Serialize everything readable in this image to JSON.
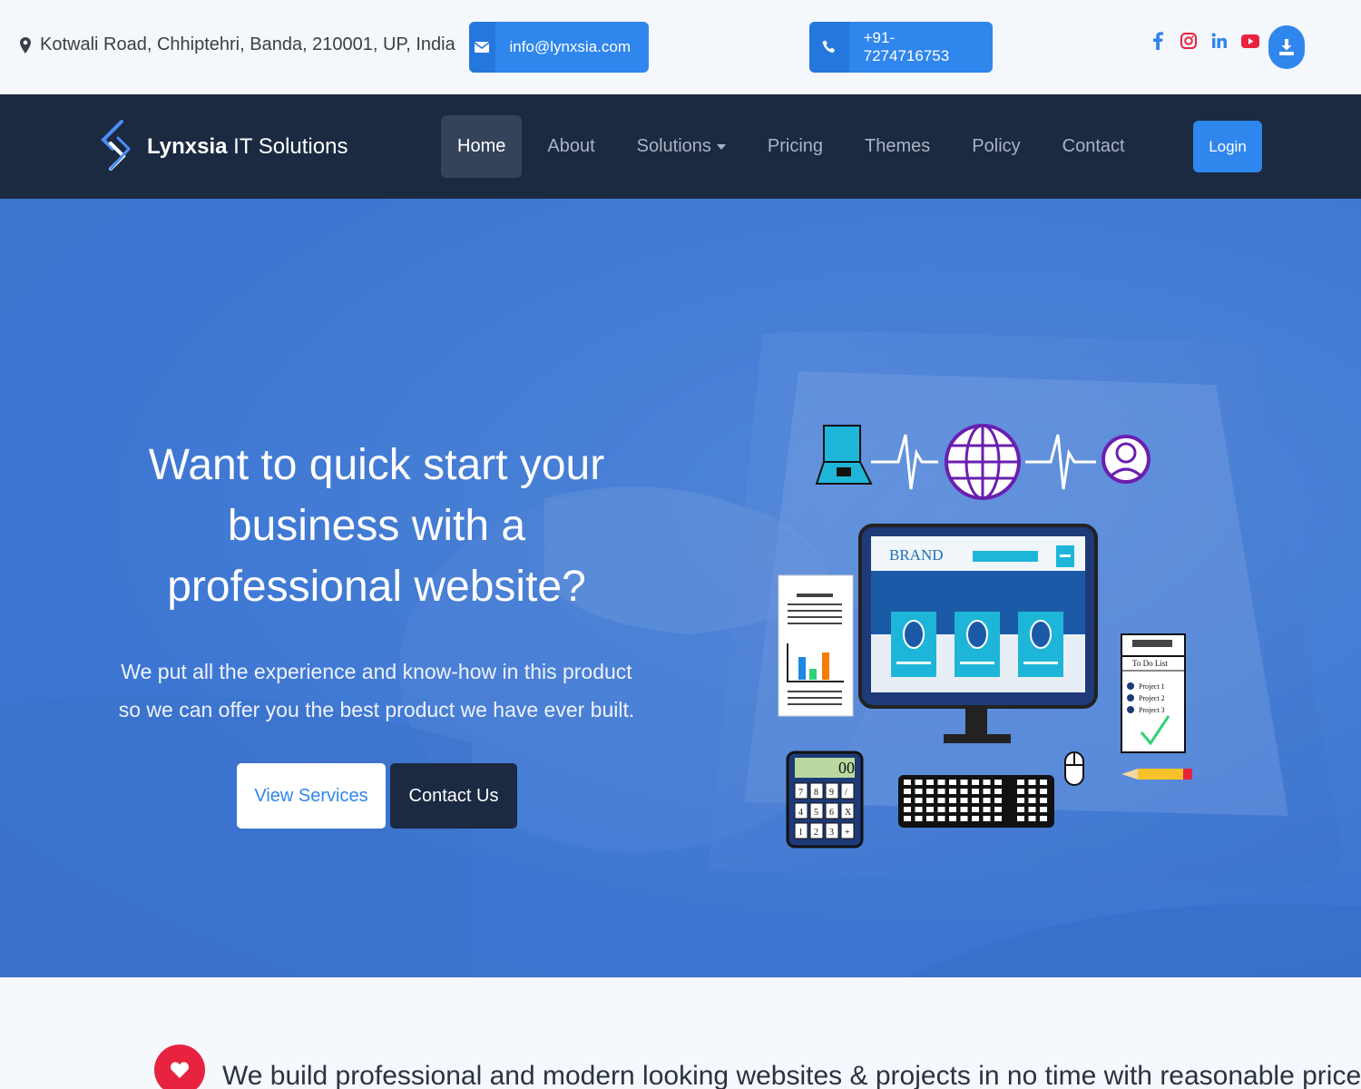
{
  "topbar": {
    "address": "Kotwali Road, Chhiptehri, Banda, 210001, UP, India",
    "email": "info@lynxsia.com",
    "phone": "+91-7274716753",
    "socials": [
      "facebook-icon",
      "instagram-icon",
      "linkedin-icon",
      "youtube-icon"
    ],
    "accent": "#2f86ec"
  },
  "navbar": {
    "brand_bold": "Lynxsia",
    "brand_rest": " IT Solutions",
    "items": [
      {
        "label": "Home",
        "active": true
      },
      {
        "label": "About"
      },
      {
        "label": "Solutions",
        "dropdown": true
      },
      {
        "label": "Pricing"
      },
      {
        "label": "Themes"
      },
      {
        "label": "Policy"
      },
      {
        "label": "Contact"
      }
    ],
    "login_label": "Login",
    "background": "#1b2941"
  },
  "hero": {
    "title_line1": "Want to quick start your",
    "title_line2": "business with a",
    "title_line3": "professional website?",
    "sub_line1": "We put all the experience and know-how in this product",
    "sub_line2": "so we can offer you the best product we have ever built.",
    "view_services_label": "View Services",
    "contact_us_label": "Contact Us",
    "illustration": {
      "brand_text": "BRAND",
      "todo_title": "To Do List",
      "todo_items": [
        "Project 1",
        "Project 2",
        "Project 3"
      ],
      "calc_display": "00",
      "calc_keys": [
        "7",
        "8",
        "9",
        "/",
        "4",
        "5",
        "6",
        "X",
        "1",
        "2",
        "3",
        "+"
      ]
    }
  },
  "bottom": {
    "tagline": "We build professional and modern looking websites & projects in no time with reasonable prices."
  }
}
